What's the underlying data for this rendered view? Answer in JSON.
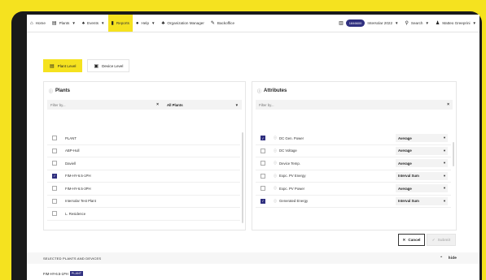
{
  "nav": {
    "home": "Home",
    "plants": "Plants",
    "events": "Events",
    "reports": "Reports",
    "help": "Help",
    "org_manager": "Organization Manager",
    "backoffice": "Backoffice",
    "badge": "1846600",
    "org": "Intersolar 2022",
    "search": "Search",
    "user": "Matteo Greeprini"
  },
  "level_tabs": {
    "plant": "Plant Level",
    "device": "Device Level"
  },
  "plants_panel": {
    "title": "Plants",
    "filter_placeholder": "Filter by...",
    "select_value": "All Plants",
    "items": [
      {
        "label": "PLANT",
        "checked": false
      },
      {
        "label": "ABP-Hull",
        "checked": false
      },
      {
        "label": "Daviell",
        "checked": false
      },
      {
        "label": "FIM-HY-6.5-1PH",
        "checked": true
      },
      {
        "label": "FIM-HY-6.5-3PH",
        "checked": false
      },
      {
        "label": "Intersolar Test Plant",
        "checked": false
      },
      {
        "label": "L. Residence",
        "checked": false
      }
    ]
  },
  "attrs_panel": {
    "title": "Attributes",
    "filter_placeholder": "Filter by...",
    "items": [
      {
        "label": "DC Gen. Power",
        "agg": "Average",
        "checked": true
      },
      {
        "label": "DC Voltage",
        "agg": "Average",
        "checked": false
      },
      {
        "label": "Device Temp.",
        "agg": "Average",
        "checked": false
      },
      {
        "label": "Expc. PV Energy",
        "agg": "Interval Sum",
        "checked": false
      },
      {
        "label": "Expc. PV Power",
        "agg": "Average",
        "checked": false
      },
      {
        "label": "Generated Energy",
        "agg": "Interval Sum",
        "checked": true
      }
    ]
  },
  "buttons": {
    "cancel": "Cancel",
    "submit": "Submit"
  },
  "selected": {
    "header": "SELECTED PLANTS AND DEVICES",
    "hide": "hide",
    "item": "FIM-HY-6.5-1PH",
    "tag": "PLANT"
  }
}
